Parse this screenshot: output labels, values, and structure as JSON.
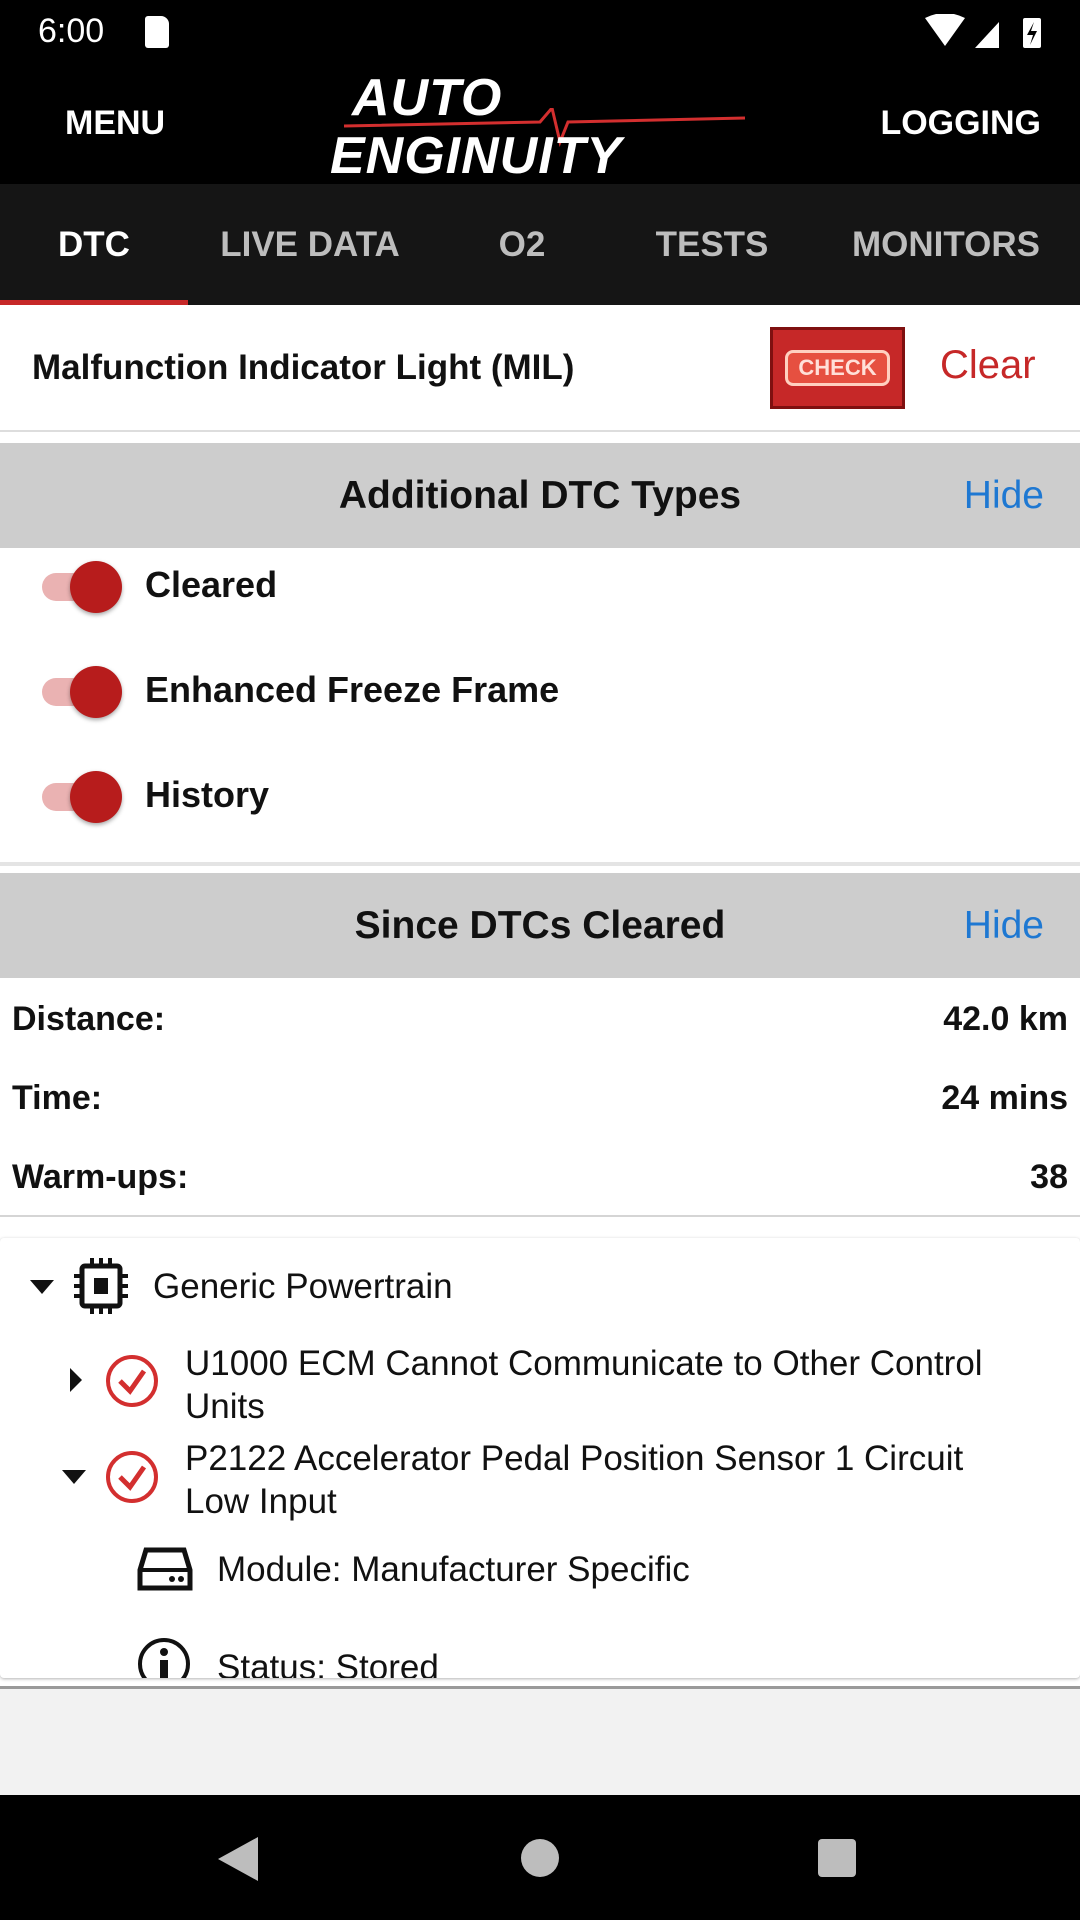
{
  "status_bar": {
    "time": "6:00",
    "icons": [
      "sd-card-icon",
      "wifi-icon",
      "signal-icon",
      "battery-charging-icon"
    ]
  },
  "header": {
    "menu": "MENU",
    "logo_line1": "AUTO",
    "logo_line2": "ENGINUITY",
    "logging": "LOGGING"
  },
  "tabs": [
    {
      "label": "DTC",
      "active": true
    },
    {
      "label": "LIVE DATA"
    },
    {
      "label": "O2"
    },
    {
      "label": "TESTS"
    },
    {
      "label": "MONITORS"
    }
  ],
  "mil": {
    "label": "Malfunction Indicator Light (MIL)",
    "icon_text": "CHECK",
    "clear": "Clear"
  },
  "additional": {
    "title": "Additional DTC Types",
    "hide": "Hide",
    "toggles": [
      {
        "label": "Cleared",
        "on": true
      },
      {
        "label": "Enhanced Freeze Frame",
        "on": true
      },
      {
        "label": "History",
        "on": true
      }
    ]
  },
  "since": {
    "title": "Since DTCs Cleared",
    "hide": "Hide",
    "rows": [
      {
        "label": "Distance:",
        "value": "42.0 km"
      },
      {
        "label": "Time:",
        "value": "24 mins"
      },
      {
        "label": "Warm-ups:",
        "value": "38"
      }
    ]
  },
  "tree": {
    "group": "Generic Powertrain",
    "dtcs": [
      {
        "line1": "U1000 ECM Cannot Communicate to Other Control",
        "line2": "Units"
      },
      {
        "line1": "P2122 Accelerator Pedal Position Sensor 1 Circuit",
        "line2": "Low Input"
      }
    ],
    "module": "Module: Manufacturer Specific",
    "status": "Status: Stored"
  },
  "colors": {
    "accent": "#c62828",
    "link": "#1e78d2"
  }
}
